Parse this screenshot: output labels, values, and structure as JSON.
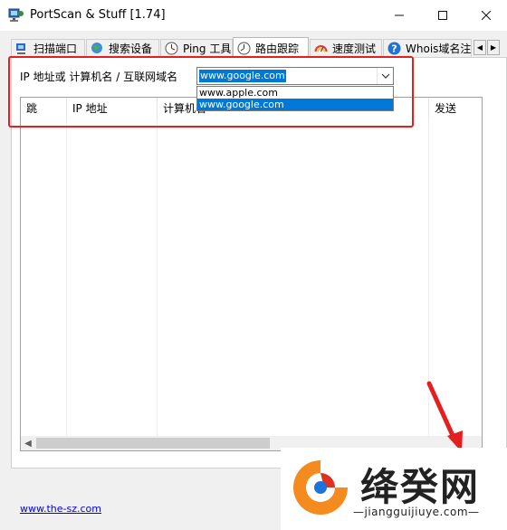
{
  "window": {
    "title": "PortScan & Stuff [1.74]",
    "min_icon": "minimize-icon",
    "max_icon": "maximize-icon",
    "close_icon": "close-icon"
  },
  "tabs": [
    {
      "label": "扫描端口",
      "icon": "scan-ports-icon"
    },
    {
      "label": "搜索设备",
      "icon": "globe-search-icon"
    },
    {
      "label": "Ping 工具",
      "icon": "clock-icon"
    },
    {
      "label": "路由跟踪",
      "icon": "trace-route-icon",
      "active": true
    },
    {
      "label": "速度测试",
      "icon": "speedometer-icon"
    },
    {
      "label": "Whois域名注",
      "icon": "help-icon"
    }
  ],
  "form": {
    "ip_label": "IP 地址或 计算机名 / 互联网域名",
    "combo_value": "www.google.com",
    "options": [
      "www.apple.com",
      "www.google.com"
    ],
    "selected_option": "www.google.com"
  },
  "table": {
    "columns": [
      "跳",
      "IP 地址",
      "计算机名",
      "发送"
    ]
  },
  "footer": {
    "link": "www.the-sz.com"
  },
  "watermark": {
    "brand": "绛癸网",
    "domain": "—jiangguijiuye.com—"
  },
  "colors": {
    "highlight": "#e51e1e",
    "selection": "#0078d7",
    "arrow": "#e51e1e"
  }
}
